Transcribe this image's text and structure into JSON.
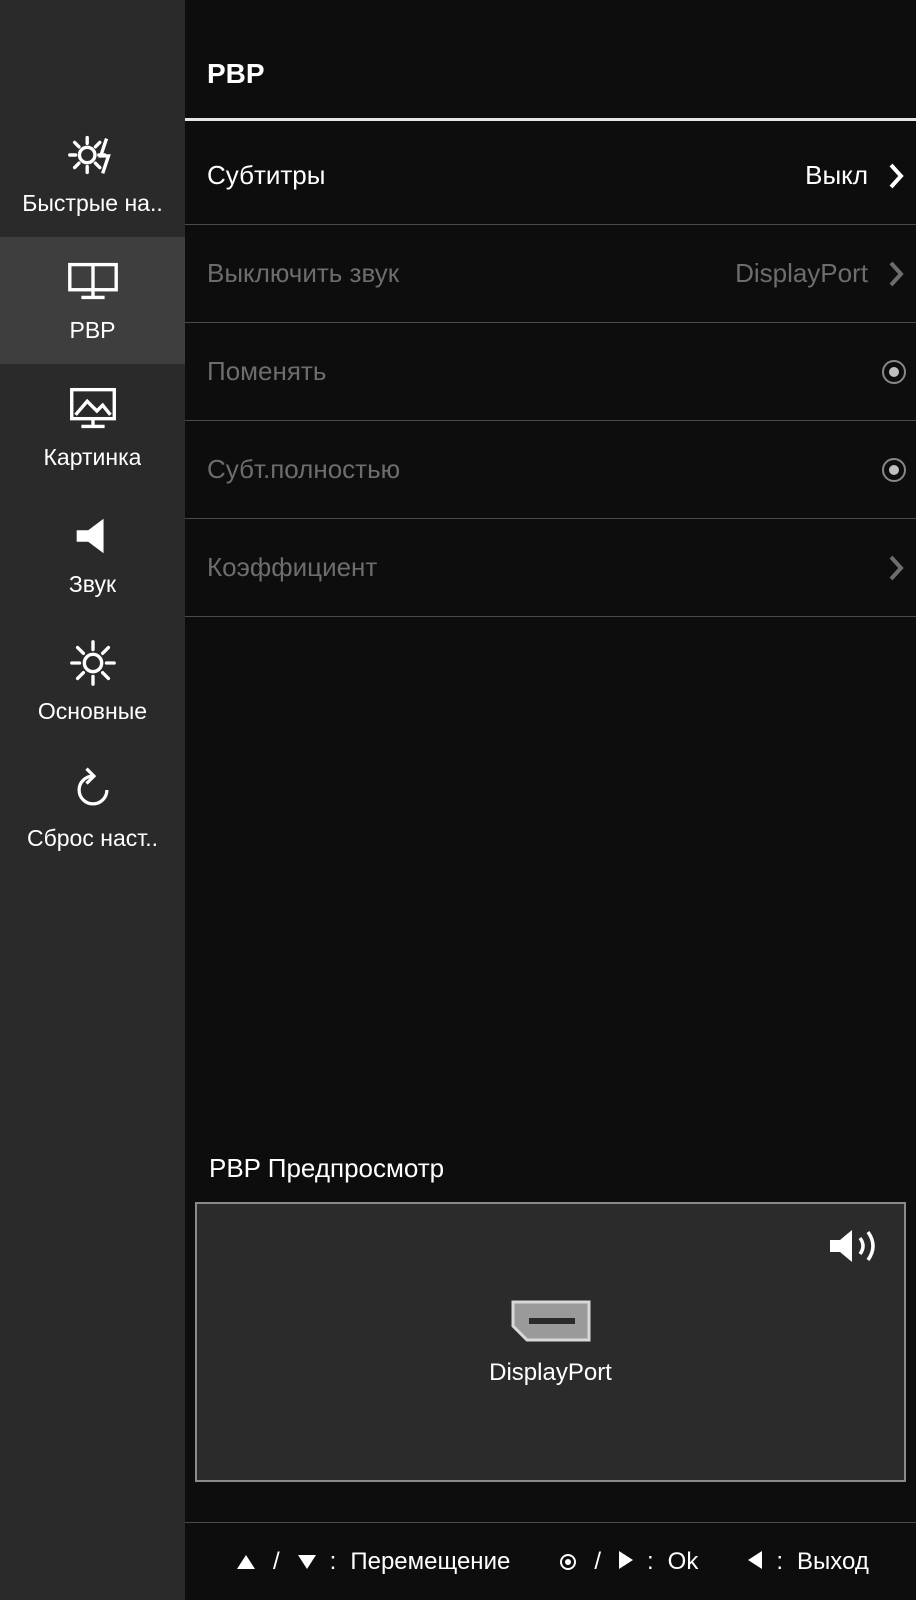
{
  "page": {
    "title": "PBP"
  },
  "sidebar": {
    "items": [
      {
        "label": "Быстрые на.."
      },
      {
        "label": "PBP"
      },
      {
        "label": "Картинка"
      },
      {
        "label": "Звук"
      },
      {
        "label": "Основные"
      },
      {
        "label": "Сброс наст.."
      }
    ]
  },
  "rows": {
    "subtitles": {
      "label": "Субтитры",
      "value": "Выкл"
    },
    "mute": {
      "label": "Выключить звук",
      "value": "DisplayPort"
    },
    "swap": {
      "label": "Поменять"
    },
    "subfull": {
      "label": "Субт.полностью"
    },
    "ratio": {
      "label": "Коэффициент"
    }
  },
  "preview": {
    "title": "PBP Предпросмотр",
    "port_label": "DisplayPort"
  },
  "footer": {
    "move": "Перемещение",
    "ok": "Ok",
    "exit": "Выход"
  }
}
